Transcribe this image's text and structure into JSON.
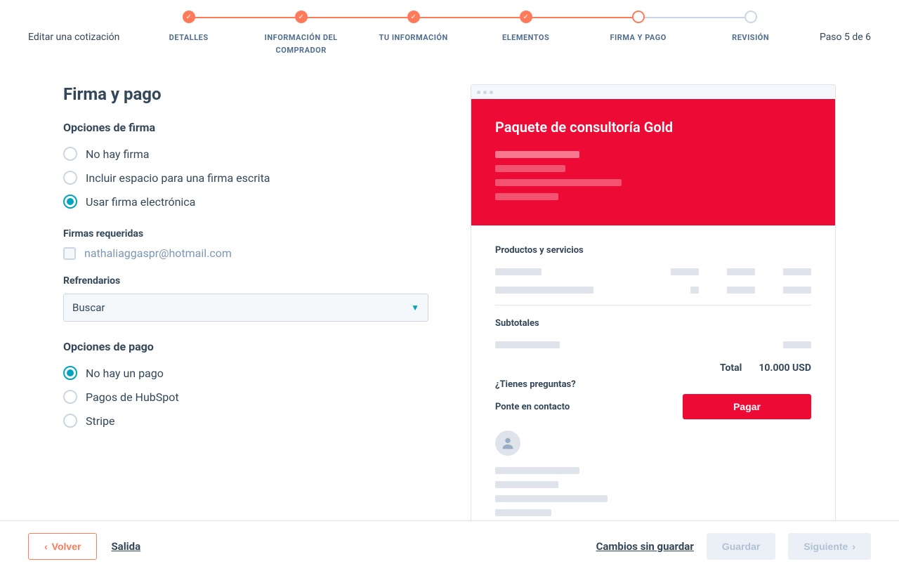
{
  "header": {
    "edit_title": "Editar una cotización",
    "step_count": "Paso 5 de 6",
    "steps": [
      {
        "label": "DETALLES",
        "state": "done"
      },
      {
        "label": "INFORMACIÓN DEL COMPRADOR",
        "state": "done"
      },
      {
        "label": "TU INFORMACIÓN",
        "state": "done"
      },
      {
        "label": "ELEMENTOS",
        "state": "done"
      },
      {
        "label": "FIRMA Y PAGO",
        "state": "current"
      },
      {
        "label": "REVISIÓN",
        "state": "pending"
      }
    ]
  },
  "page": {
    "title": "Firma y pago",
    "signature_section": "Opciones de firma",
    "signature_options": {
      "none": "No hay firma",
      "written": "Incluir espacio para una firma escrita",
      "electronic": "Usar firma electrónica"
    },
    "signature_selected": "electronic",
    "required_sigs_label": "Firmas requeridas",
    "required_sig_email": "nathaliaggaspr@hotmail.com",
    "countersigners_label": "Refrendarios",
    "countersigners_placeholder": "Buscar",
    "payment_section": "Opciones de pago",
    "payment_options": {
      "none": "No hay un pago",
      "hubspot": "Pagos de HubSpot",
      "stripe": "Stripe"
    },
    "payment_selected": "none"
  },
  "preview": {
    "title": "Paquete de consultoría Gold",
    "products_label": "Productos y servicios",
    "subtotals_label": "Subtotales",
    "total_label": "Total",
    "total_value": "10.000 USD",
    "questions": "¿Tienes preguntas?",
    "contact": "Ponte en contacto",
    "pay_button": "Pagar"
  },
  "footer": {
    "back": "Volver",
    "exit": "Salida",
    "unsaved": "Cambios sin guardar",
    "save": "Guardar",
    "next": "Siguiente"
  }
}
